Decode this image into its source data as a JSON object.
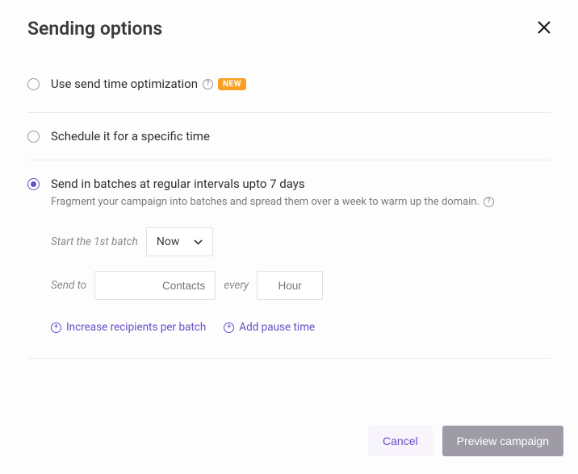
{
  "title": "Sending options",
  "options": {
    "optimize": {
      "label": "Use send time optimization",
      "badge": "NEW"
    },
    "schedule": {
      "label": "Schedule it for a specific time"
    },
    "batches": {
      "label": "Send in batches at regular intervals upto 7 days",
      "desc": "Fragment your campaign into batches and spread them over a week to warm up the domain.",
      "start_label": "Start the 1st batch",
      "start_value": "Now",
      "sendto_label": "Send to",
      "contacts_placeholder": "Contacts",
      "contacts_value": "",
      "every_label": "every",
      "hour_placeholder": "Hour",
      "hour_value": "",
      "increase_link": "Increase recipients per batch",
      "pause_link": "Add pause time"
    }
  },
  "footer": {
    "cancel": "Cancel",
    "preview": "Preview campaign"
  }
}
